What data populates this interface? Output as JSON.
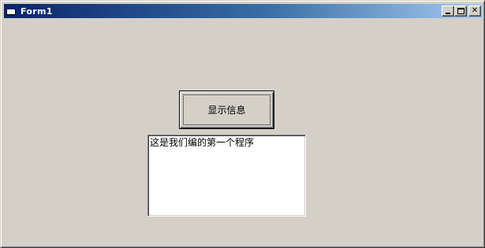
{
  "window": {
    "title": "Form1",
    "controls": {
      "minimize_icon": "minimize-icon",
      "maximize_icon": "maximize-icon",
      "close_glyph": "✕"
    },
    "colors": {
      "face": "#d4d0c8",
      "titlebar_start": "#0a246a",
      "titlebar_end": "#a6caf0"
    }
  },
  "form": {
    "show_button_label": "显示信息",
    "text_box_value": "这是我们编的第一个程序"
  }
}
